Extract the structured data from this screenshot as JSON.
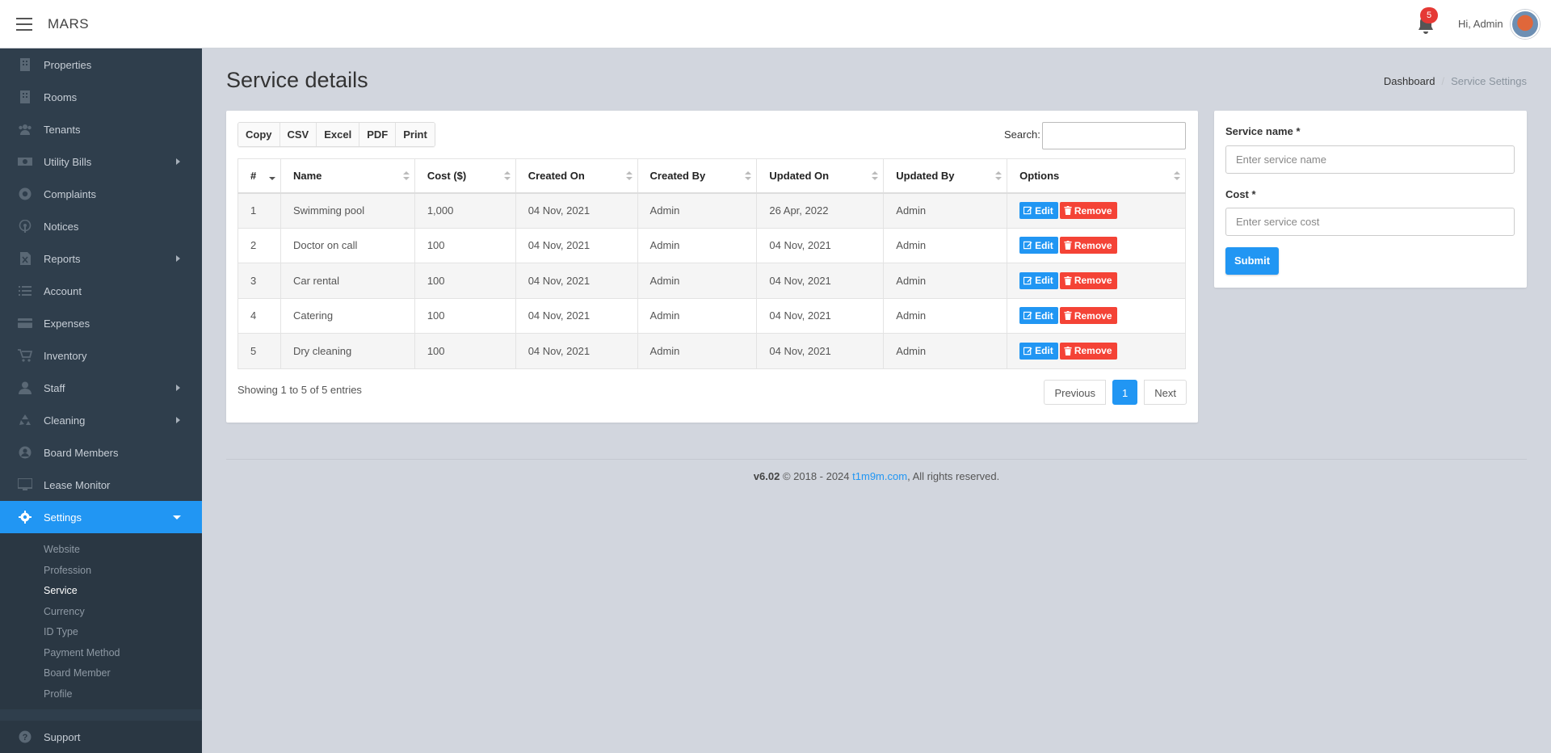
{
  "app": {
    "brand": "MARS",
    "notification_count": "5",
    "greeting": "Hi, Admin"
  },
  "sidebar": {
    "items": [
      {
        "label": "Properties",
        "icon": "building-icon",
        "has_submenu": false
      },
      {
        "label": "Rooms",
        "icon": "building-icon",
        "has_submenu": false
      },
      {
        "label": "Tenants",
        "icon": "users-icon",
        "has_submenu": false
      },
      {
        "label": "Utility Bills",
        "icon": "money-icon",
        "has_submenu": true
      },
      {
        "label": "Complaints",
        "icon": "support-icon",
        "has_submenu": false
      },
      {
        "label": "Notices",
        "icon": "podcast-icon",
        "has_submenu": false
      },
      {
        "label": "Reports",
        "icon": "excel-file-icon",
        "has_submenu": true
      },
      {
        "label": "Account",
        "icon": "list-icon",
        "has_submenu": false
      },
      {
        "label": "Expenses",
        "icon": "credit-card-icon",
        "has_submenu": false
      },
      {
        "label": "Inventory",
        "icon": "cart-icon",
        "has_submenu": false
      },
      {
        "label": "Staff",
        "icon": "user-icon",
        "has_submenu": true
      },
      {
        "label": "Cleaning",
        "icon": "recycle-icon",
        "has_submenu": true
      },
      {
        "label": "Board Members",
        "icon": "user-circle-icon",
        "has_submenu": false
      },
      {
        "label": "Lease Monitor",
        "icon": "monitor-icon",
        "has_submenu": false
      },
      {
        "label": "Settings",
        "icon": "gear-icon",
        "has_submenu": true,
        "active": true
      }
    ],
    "settings_submenu": [
      "Website",
      "Profession",
      "Service",
      "Currency",
      "ID Type",
      "Payment Method",
      "Board Member",
      "Profile"
    ],
    "current_submenu": "Service",
    "support_label": "Support"
  },
  "page": {
    "title": "Service details",
    "breadcrumb": [
      "Dashboard",
      "Service Settings"
    ]
  },
  "table": {
    "export_buttons": [
      "Copy",
      "CSV",
      "Excel",
      "PDF",
      "Print"
    ],
    "search_label": "Search:",
    "search_value": "",
    "columns": [
      "#",
      "Name",
      "Cost ($)",
      "Created On",
      "Created By",
      "Updated On",
      "Updated By",
      "Options"
    ],
    "rows": [
      [
        "1",
        "Swimming pool",
        "1,000",
        "04 Nov, 2021",
        "Admin",
        "26 Apr, 2022",
        "Admin"
      ],
      [
        "2",
        "Doctor on call",
        "100",
        "04 Nov, 2021",
        "Admin",
        "04 Nov, 2021",
        "Admin"
      ],
      [
        "3",
        "Car rental",
        "100",
        "04 Nov, 2021",
        "Admin",
        "04 Nov, 2021",
        "Admin"
      ],
      [
        "4",
        "Catering",
        "100",
        "04 Nov, 2021",
        "Admin",
        "04 Nov, 2021",
        "Admin"
      ],
      [
        "5",
        "Dry cleaning",
        "100",
        "04 Nov, 2021",
        "Admin",
        "04 Nov, 2021",
        "Admin"
      ]
    ],
    "edit_label": "Edit",
    "remove_label": "Remove",
    "summary": "Showing 1 to 5 of 5 entries",
    "pagination": {
      "previous": "Previous",
      "current": "1",
      "next": "Next"
    }
  },
  "form": {
    "name_label": "Service name *",
    "name_placeholder": "Enter service name",
    "cost_label": "Cost *",
    "cost_placeholder": "Enter service cost",
    "submit_label": "Submit"
  },
  "footer": {
    "version": "v6.02",
    "copyright": "© 2018 - 2024",
    "link": "t1m9m.com",
    "rights": ", All rights reserved."
  },
  "colors": {
    "primary": "#2196f3",
    "danger": "#f44336",
    "sidebar": "#2f3e4c",
    "background": "#d2d6de"
  }
}
